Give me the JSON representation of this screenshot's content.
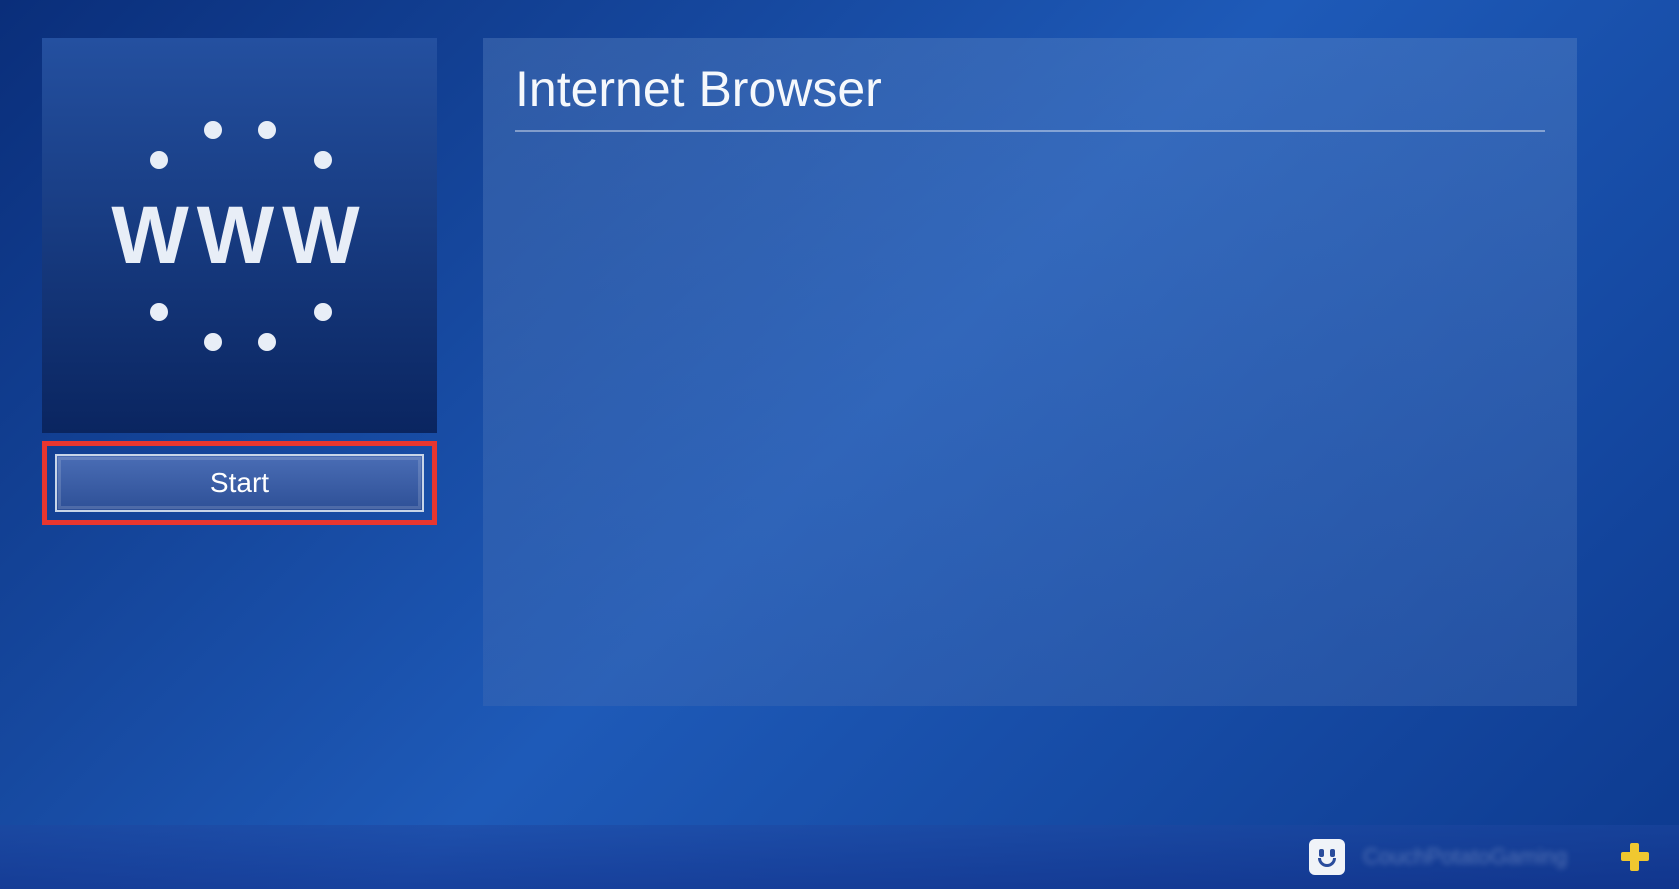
{
  "app": {
    "icon_text": "WWW",
    "start_label": "Start"
  },
  "content": {
    "title": "Internet Browser"
  },
  "bottom_bar": {
    "profile_name": "CouchPotatoGaming"
  }
}
